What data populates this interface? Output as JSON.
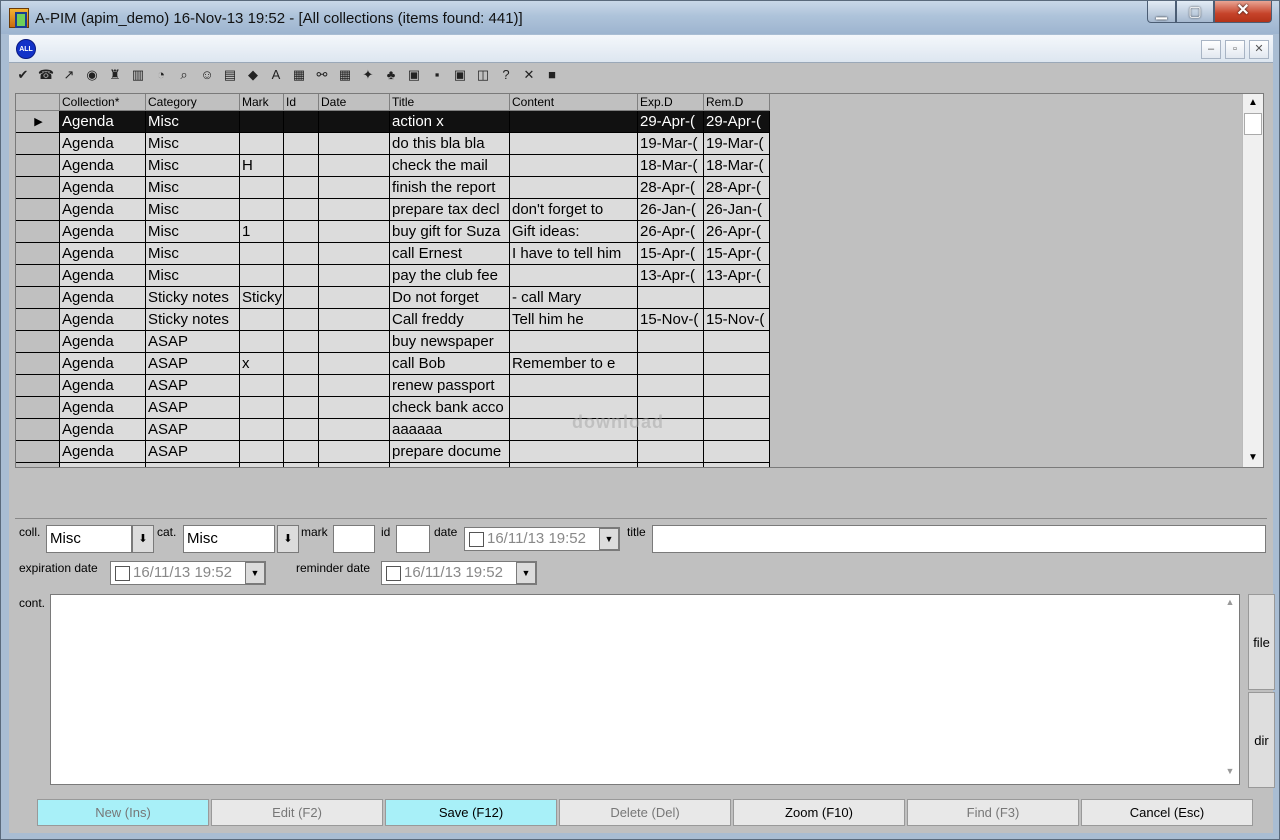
{
  "window": {
    "title": "A-PIM (apim_demo) 16-Nov-13 19:52 - [All collections (items found: 441)]",
    "min_glyph": "▁",
    "max_glyph": "▢",
    "close_glyph": "✕"
  },
  "mdi": {
    "badge": "ALL",
    "min_glyph": "–",
    "restore_glyph": "▫",
    "close_glyph": "✕"
  },
  "toolbar": {
    "icons": [
      "check-icon",
      "phone-icon",
      "arrow-icon",
      "globe-icon",
      "moneybag-icon",
      "book-icon",
      "clock-icon",
      "search-doc-icon",
      "person-icon",
      "printer-icon",
      "eraser-icon",
      "all-icon",
      "notes-icon",
      "binoculars-icon",
      "grid-icon",
      "star-grid-icon",
      "tree-icon",
      "export-icon",
      "save-icon",
      "lock-icon",
      "database-icon",
      "help-icon",
      "tools-icon",
      "terminal-icon"
    ],
    "glyphs": [
      "✔",
      "☎",
      "↗",
      "◉",
      "♜",
      "▥",
      "◔",
      "⌕",
      "☺",
      "▤",
      "◆",
      "A",
      "▦",
      "⚯",
      "▦",
      "✦",
      "♣",
      "▣",
      "▪",
      "▣",
      "◫",
      "?",
      "✕",
      "■"
    ]
  },
  "grid": {
    "columns": [
      "Collection*",
      "Category",
      "Mark",
      "Id",
      "Date",
      "Title",
      "Content",
      "Exp.D",
      "Rem.D"
    ],
    "selected_indicator": "▶",
    "rows": [
      [
        "Agenda",
        "Misc",
        "",
        "",
        "",
        "action x",
        "",
        "29-Apr-(",
        "29-Apr-("
      ],
      [
        "Agenda",
        "Misc",
        "",
        "",
        "",
        "do this bla bla",
        "",
        "19-Mar-(",
        "19-Mar-("
      ],
      [
        "Agenda",
        "Misc",
        "H",
        "",
        "",
        "check the mail",
        "",
        "18-Mar-(",
        "18-Mar-("
      ],
      [
        "Agenda",
        "Misc",
        "",
        "",
        "",
        "finish the report",
        "",
        "28-Apr-(",
        "28-Apr-("
      ],
      [
        "Agenda",
        "Misc",
        "",
        "",
        "",
        "prepare tax decl",
        "don't forget to",
        "26-Jan-(",
        "26-Jan-("
      ],
      [
        "Agenda",
        "Misc",
        "1",
        "",
        "",
        "buy gift for Suza",
        "Gift ideas:",
        "26-Apr-(",
        "26-Apr-("
      ],
      [
        "Agenda",
        "Misc",
        "",
        "",
        "",
        "call Ernest",
        "I have to tell him",
        "15-Apr-(",
        "15-Apr-("
      ],
      [
        "Agenda",
        "Misc",
        "",
        "",
        "",
        "pay the club fee",
        "",
        "13-Apr-(",
        "13-Apr-("
      ],
      [
        "Agenda",
        "Sticky notes",
        "Sticky",
        "",
        "",
        "Do not forget",
        "- call Mary",
        "",
        ""
      ],
      [
        "Agenda",
        "Sticky notes",
        "",
        "",
        "",
        "Call freddy",
        "Tell him he",
        "15-Nov-(",
        "15-Nov-("
      ],
      [
        "Agenda",
        "ASAP",
        "",
        "",
        "",
        "buy newspaper",
        "",
        "",
        ""
      ],
      [
        "Agenda",
        "ASAP",
        "x",
        "",
        "",
        "call  Bob",
        "Remember to e",
        "",
        ""
      ],
      [
        "Agenda",
        "ASAP",
        "",
        "",
        "",
        "renew passport",
        "",
        "",
        ""
      ],
      [
        "Agenda",
        "ASAP",
        "",
        "",
        "",
        "check bank acco",
        "",
        "",
        ""
      ],
      [
        "Agenda",
        "ASAP",
        "",
        "",
        "",
        "aaaaaa",
        "",
        "",
        ""
      ],
      [
        "Agenda",
        "ASAP",
        "",
        "",
        "",
        "prepare docume",
        "",
        "",
        ""
      ],
      [
        "Agenda",
        "ASAP",
        "",
        "",
        "",
        "call the doctor",
        "",
        "",
        ""
      ]
    ],
    "scroll_up": "▲",
    "scroll_down": "▼",
    "watermark": "download"
  },
  "form": {
    "coll_label": "coll.",
    "coll_value": "Misc",
    "cat_label": "cat.",
    "cat_value": "Misc",
    "dd_glyph": "⬇",
    "mark_label": "mark",
    "id_label": "id",
    "date_label": "date",
    "date_value": "16/11/13 19:52",
    "title_label": "title",
    "title_value": "",
    "expiration_label": "expiration date",
    "expiration_value": "16/11/13 19:52",
    "reminder_label": "reminder date",
    "reminder_value": "16/11/13 19:52",
    "combo_glyph": "▼",
    "cont_label": "cont.",
    "file_button": "file",
    "dir_button": "dir",
    "ta_up": "▲",
    "ta_down": "▼"
  },
  "buttons": {
    "new": "New (Ins)",
    "edit": "Edit (F2)",
    "save": "Save (F12)",
    "delete": "Delete (Del)",
    "zoom": "Zoom (F10)",
    "find": "Find (F3)",
    "cancel": "Cancel (Esc)"
  }
}
